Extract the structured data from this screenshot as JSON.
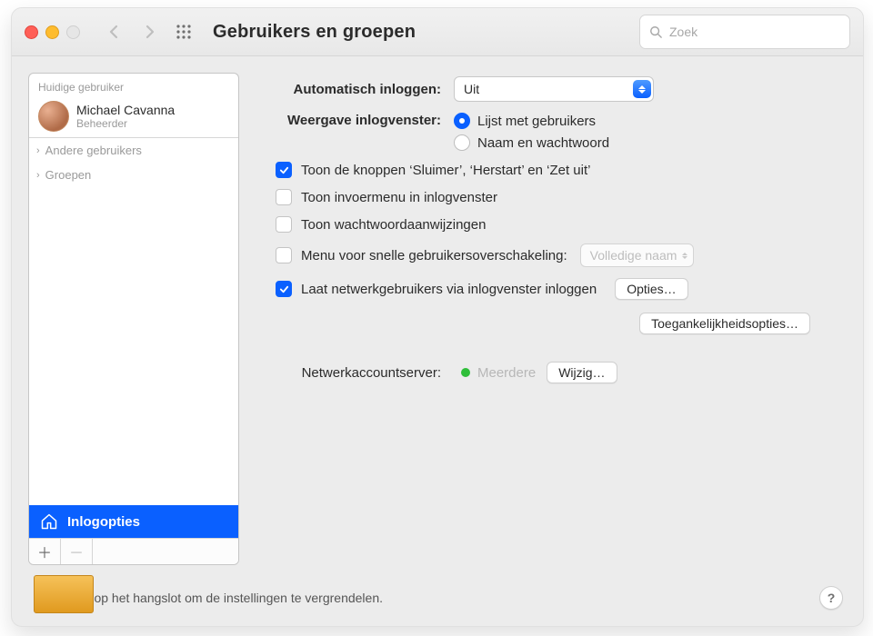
{
  "window": {
    "title": "Gebruikers en groepen"
  },
  "search": {
    "placeholder": "Zoek"
  },
  "sidebar": {
    "section_current": "Huidige gebruiker",
    "user": {
      "name": "Michael Cavanna",
      "role": "Beheerder"
    },
    "items": [
      {
        "label": "Andere gebruikers"
      },
      {
        "label": "Groepen"
      }
    ],
    "login_options": "Inlogopties",
    "add_tooltip": "Voeg toe",
    "remove_tooltip": "Verwijder"
  },
  "content": {
    "auto_login_label": "Automatisch inloggen:",
    "auto_login_value": "Uit",
    "login_display_label": "Weergave inlogvenster:",
    "login_display_options": {
      "list": "Lijst met gebruikers",
      "namepw": "Naam en wachtwoord"
    },
    "checkboxes": {
      "sleep_restart": "Toon de knoppen ‘Sluimer’, ‘Herstart’ en ‘Zet uit’",
      "input_menu": "Toon invoermenu in inlogvenster",
      "pw_hints": "Toon wachtwoordaanwijzingen",
      "fast_switch_label": "Menu voor snelle gebruikersoverschakeling:",
      "fast_switch_value": "Volledige naam",
      "network_login": "Laat netwerkgebruikers via inlogvenster inloggen"
    },
    "options_btn": "Opties…",
    "accessibility_btn": "Toegankelijkheidsopties…",
    "network_server_label": "Netwerkaccountserver:",
    "network_server_value": "Meerdere",
    "edit_btn": "Wijzig…"
  },
  "colors": {
    "status_green": "#2fbe3a",
    "accent_blue": "#0a60ff"
  },
  "footer": {
    "lock_text": "Klik op het hangslot om de instellingen te vergrendelen.",
    "help": "?"
  }
}
